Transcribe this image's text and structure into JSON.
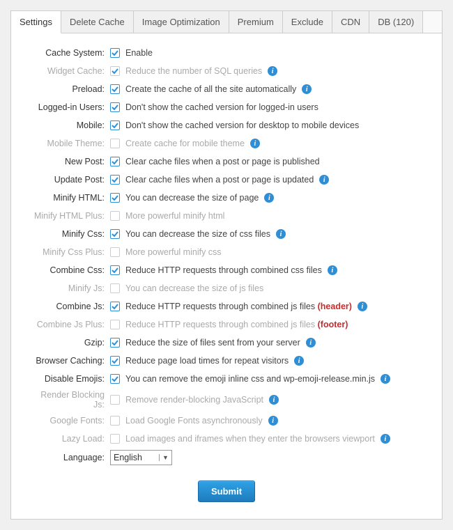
{
  "tabs": [
    "Settings",
    "Delete Cache",
    "Image Optimization",
    "Premium",
    "Exclude",
    "CDN",
    "DB (120)"
  ],
  "rows": [
    {
      "label": "Cache System:",
      "checked": true,
      "disabled": false,
      "desc": "Enable",
      "info": false
    },
    {
      "label": "Widget Cache:",
      "checked": true,
      "disabled": true,
      "desc": "Reduce the number of SQL queries",
      "info": true
    },
    {
      "label": "Preload:",
      "checked": true,
      "disabled": false,
      "desc": "Create the cache of all the site automatically",
      "info": true
    },
    {
      "label": "Logged-in Users:",
      "checked": true,
      "disabled": false,
      "desc": "Don't show the cached version for logged-in users",
      "info": false
    },
    {
      "label": "Mobile:",
      "checked": true,
      "disabled": false,
      "desc": "Don't show the cached version for desktop to mobile devices",
      "info": false
    },
    {
      "label": "Mobile Theme:",
      "checked": false,
      "disabled": true,
      "desc": "Create cache for mobile theme",
      "info": true
    },
    {
      "label": "New Post:",
      "checked": true,
      "disabled": false,
      "desc": "Clear cache files when a post or page is published",
      "info": false
    },
    {
      "label": "Update Post:",
      "checked": true,
      "disabled": false,
      "desc": "Clear cache files when a post or page is updated",
      "info": true
    },
    {
      "label": "Minify HTML:",
      "checked": true,
      "disabled": false,
      "desc": "You can decrease the size of page",
      "info": true
    },
    {
      "label": "Minify HTML Plus:",
      "checked": false,
      "disabled": true,
      "desc": "More powerful minify html",
      "info": false
    },
    {
      "label": "Minify Css:",
      "checked": true,
      "disabled": false,
      "desc": "You can decrease the size of css files",
      "info": true
    },
    {
      "label": "Minify Css Plus:",
      "checked": false,
      "disabled": true,
      "desc": "More powerful minify css",
      "info": false
    },
    {
      "label": "Combine Css:",
      "checked": true,
      "disabled": false,
      "desc": "Reduce HTTP requests through combined css files",
      "info": true
    },
    {
      "label": "Minify Js:",
      "checked": false,
      "disabled": true,
      "desc": "You can decrease the size of js files",
      "info": false
    },
    {
      "label": "Combine Js:",
      "checked": true,
      "disabled": false,
      "desc": "Reduce HTTP requests through combined js files",
      "info": true,
      "suffix_red": "(header)"
    },
    {
      "label": "Combine Js Plus:",
      "checked": false,
      "disabled": true,
      "desc": "Reduce HTTP requests through combined js files",
      "info": false,
      "suffix_red": "(footer)"
    },
    {
      "label": "Gzip:",
      "checked": true,
      "disabled": false,
      "desc": "Reduce the size of files sent from your server",
      "info": true
    },
    {
      "label": "Browser Caching:",
      "checked": true,
      "disabled": false,
      "desc": "Reduce page load times for repeat visitors",
      "info": true
    },
    {
      "label": "Disable Emojis:",
      "checked": true,
      "disabled": false,
      "desc": "You can remove the emoji inline css and wp-emoji-release.min.js",
      "info": true
    },
    {
      "label": "Render Blocking Js:",
      "checked": false,
      "disabled": true,
      "desc": "Remove render-blocking JavaScript",
      "info": true
    },
    {
      "label": "Google Fonts:",
      "checked": false,
      "disabled": true,
      "desc": "Load Google Fonts asynchronously",
      "info": true
    },
    {
      "label": "Lazy Load:",
      "checked": false,
      "disabled": true,
      "desc": "Load images and iframes when they enter the browsers viewport",
      "info": true
    }
  ],
  "language": {
    "label": "Language:",
    "value": "English"
  },
  "submit": "Submit"
}
